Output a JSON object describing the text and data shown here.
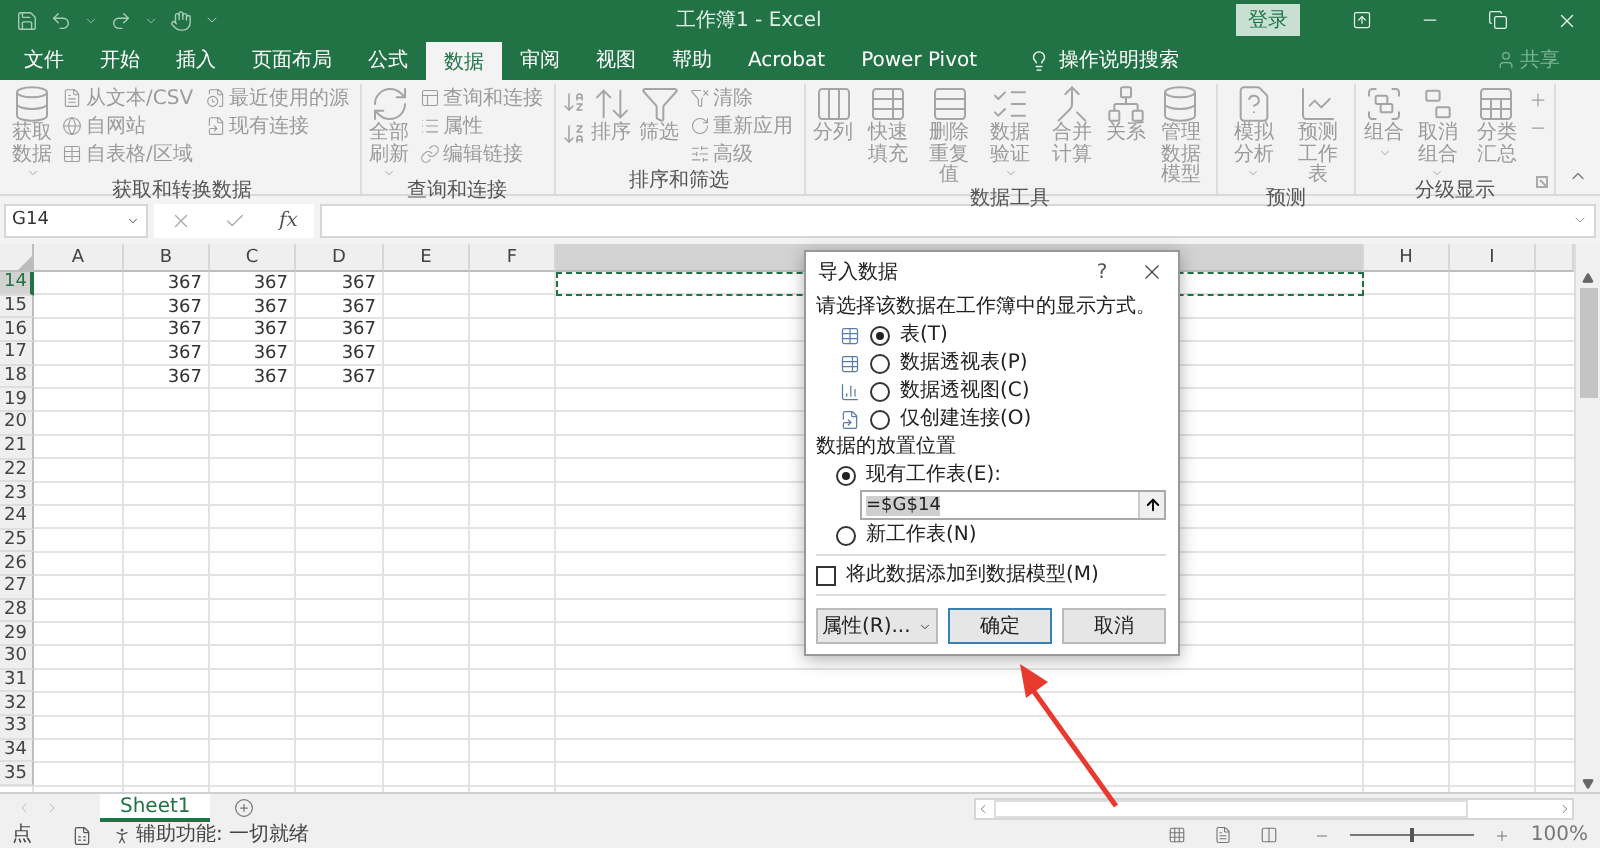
{
  "title_bar": {
    "title": "工作簿1 - Excel",
    "sign_in": "登录"
  },
  "tabs": [
    {
      "label": "文件",
      "selected": false
    },
    {
      "label": "开始",
      "selected": false
    },
    {
      "label": "插入",
      "selected": false
    },
    {
      "label": "页面布局",
      "selected": false
    },
    {
      "label": "公式",
      "selected": false
    },
    {
      "label": "数据",
      "selected": true
    },
    {
      "label": "审阅",
      "selected": false
    },
    {
      "label": "视图",
      "selected": false
    },
    {
      "label": "帮助",
      "selected": false
    },
    {
      "label": "Acrobat",
      "selected": false
    },
    {
      "label": "Power Pivot",
      "selected": false
    }
  ],
  "tell_me": "操作说明搜索",
  "share": "共享",
  "ribbon": {
    "groups": [
      {
        "label": "获取和转换数据",
        "items": [
          {
            "kind": "large",
            "label": "获取数据",
            "dropdown": true
          },
          {
            "kind": "small",
            "label": "从文本/CSV"
          },
          {
            "kind": "small",
            "label": "自网站"
          },
          {
            "kind": "small",
            "label": "自表格/区域"
          },
          {
            "kind": "small",
            "label": "最近使用的源"
          },
          {
            "kind": "small",
            "label": "现有连接"
          }
        ]
      },
      {
        "label": "查询和连接",
        "items": [
          {
            "kind": "large",
            "label": "全部刷新",
            "dropdown": true
          },
          {
            "kind": "small",
            "label": "查询和连接"
          },
          {
            "kind": "small",
            "label": "属性"
          },
          {
            "kind": "small",
            "label": "编辑链接"
          }
        ]
      },
      {
        "label": "排序和筛选",
        "items": [
          {
            "kind": "sort-pair"
          },
          {
            "kind": "large",
            "label": "排序"
          },
          {
            "kind": "large",
            "label": "筛选"
          },
          {
            "kind": "small",
            "label": "清除"
          },
          {
            "kind": "small",
            "label": "重新应用"
          },
          {
            "kind": "small",
            "label": "高级"
          }
        ]
      },
      {
        "label": "数据工具",
        "items": [
          {
            "kind": "large",
            "label": "分列"
          },
          {
            "kind": "large",
            "label": "快速填充"
          },
          {
            "kind": "large",
            "label": "删除重复值"
          },
          {
            "kind": "large",
            "label": "数据验证",
            "dropdown": true
          },
          {
            "kind": "large",
            "label": "合并计算"
          },
          {
            "kind": "large",
            "label": "关系"
          },
          {
            "kind": "large",
            "label": "管理数据模型"
          }
        ]
      },
      {
        "label": "预测",
        "items": [
          {
            "kind": "large",
            "label": "模拟分析",
            "dropdown": true
          },
          {
            "kind": "large",
            "label": "预测工作表"
          }
        ]
      },
      {
        "label": "分级显示",
        "launcher": true,
        "items": [
          {
            "kind": "large",
            "label": "组合",
            "dropdown": true
          },
          {
            "kind": "large",
            "label": "取消组合",
            "dropdown": true
          },
          {
            "kind": "large",
            "label": "分类汇总"
          },
          {
            "kind": "detail-pair"
          }
        ]
      }
    ]
  },
  "formula_bar": {
    "name_box": "G14",
    "function_label": "fx"
  },
  "sheet": {
    "columns": [
      {
        "label": "A",
        "selected": false
      },
      {
        "label": "B",
        "selected": false
      },
      {
        "label": "C",
        "selected": false
      },
      {
        "label": "D",
        "selected": false
      },
      {
        "label": "E",
        "selected": false
      },
      {
        "label": "F",
        "selected": false
      },
      {
        "selected": true
      },
      {
        "label": "H",
        "selected": false
      },
      {
        "label": "I",
        "selected": false
      }
    ],
    "rows": [
      {
        "number": "14",
        "selected": true,
        "values": [
          "367",
          "367",
          "367"
        ]
      },
      {
        "number": "15",
        "selected": false,
        "values": [
          "367",
          "367",
          "367"
        ]
      },
      {
        "number": "16",
        "selected": false,
        "values": [
          "367",
          "367",
          "367"
        ]
      },
      {
        "number": "17",
        "selected": false,
        "values": [
          "367",
          "367",
          "367"
        ]
      },
      {
        "number": "18",
        "selected": false,
        "values": [
          "367",
          "367",
          "367"
        ]
      },
      {
        "number": "19",
        "selected": false
      },
      {
        "number": "20",
        "selected": false
      },
      {
        "number": "21",
        "selected": false
      },
      {
        "number": "22",
        "selected": false
      },
      {
        "number": "23",
        "selected": false
      },
      {
        "number": "24",
        "selected": false
      },
      {
        "number": "25",
        "selected": false
      },
      {
        "number": "26",
        "selected": false
      },
      {
        "number": "27",
        "selected": false
      },
      {
        "number": "28",
        "selected": false
      },
      {
        "number": "29",
        "selected": false
      },
      {
        "number": "30",
        "selected": false
      },
      {
        "number": "31",
        "selected": false
      },
      {
        "number": "32",
        "selected": false
      },
      {
        "number": "33",
        "selected": false
      },
      {
        "number": "34",
        "selected": false
      },
      {
        "number": "35",
        "selected": false
      }
    ]
  },
  "sheet_tabs": [
    {
      "label": "Sheet1",
      "selected": true
    }
  ],
  "status_bar": {
    "mode": "点",
    "accessibility": "辅助功能: 一切就绪",
    "zoom": {
      "level": 0.5,
      "reading": "100%"
    }
  },
  "dialog": {
    "title": "导入数据",
    "help": "?",
    "prompt": "请选择该数据在工作簿中的显示方式。",
    "views": [
      {
        "label": "表(T)",
        "selected": true
      },
      {
        "label": "数据透视表(P)",
        "selected": false
      },
      {
        "label": "数据透视图(C)",
        "selected": false
      },
      {
        "label": "仅创建连接(O)",
        "selected": false
      }
    ],
    "placement_heading": "数据的放置位置",
    "placements": [
      {
        "label": "现有工作表(E):",
        "selected": true,
        "value": "=$G$14"
      },
      {
        "label": "新工作表(N)",
        "selected": false
      }
    ],
    "data_model": {
      "label": "将此数据添加到数据模型(M)",
      "checked": false
    },
    "buttons": [
      {
        "label": "属性(R)...",
        "kind": "menu"
      },
      {
        "label": "确定",
        "kind": "default"
      },
      {
        "label": "取消",
        "kind": "plain"
      }
    ]
  }
}
